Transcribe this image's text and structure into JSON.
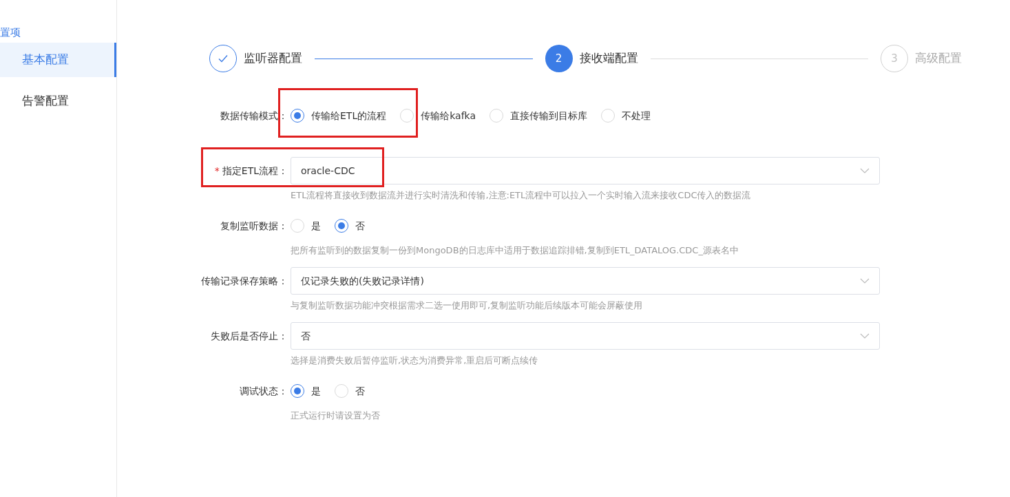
{
  "sidebar": {
    "title": "置项",
    "items": [
      {
        "label": "基本配置",
        "selected": true
      },
      {
        "label": "告警配置",
        "selected": false
      }
    ]
  },
  "steps": [
    {
      "label": "监听器配置",
      "completed": true,
      "selected": false
    },
    {
      "number": "2",
      "label": "接收端配置",
      "completed": false,
      "selected": true
    },
    {
      "number": "3",
      "label": "高级配置",
      "completed": false,
      "selected": false
    }
  ],
  "form": [
    {
      "kind": "radio",
      "label": "数据传输模式：",
      "options": [
        {
          "label": "传输给ETL的流程",
          "selected": true,
          "highlighted": true
        },
        {
          "label": "传输给kafka",
          "selected": false,
          "highlighted": false
        },
        {
          "label": "直接传输到目标库",
          "selected": false,
          "highlighted": false
        },
        {
          "label": "不处理",
          "selected": false,
          "highlighted": false
        }
      ]
    },
    {
      "kind": "select",
      "required_mark": "*",
      "label": "指定ETL流程：",
      "highlighted": true,
      "value": "oracle-CDC",
      "help": "ETL流程将直接收到数据流并进行实时清洗和传输,注意:ETL流程中可以拉入一个实时输入流来接收CDC传入的数据流"
    },
    {
      "kind": "radio",
      "label": "复制监听数据：",
      "options": [
        {
          "label": "是",
          "selected": false,
          "highlighted": false
        },
        {
          "label": "否",
          "selected": true,
          "highlighted": false
        }
      ],
      "help": "把所有监听到的数据复制一份到MongoDB的日志库中适用于数据追踪排错,复制到ETL_DATALOG.CDC_源表名中"
    },
    {
      "kind": "select",
      "label": "传输记录保存策略：",
      "highlighted": false,
      "value": "仅记录失败的(失败记录详情)",
      "help": "与复制监听数据功能冲突根据需求二选一使用即可,复制监听功能后续版本可能会屏蔽使用"
    },
    {
      "kind": "select",
      "label": "失败后是否停止：",
      "highlighted": false,
      "value": "否",
      "help": "选择是消费失败后暂停监听,状态为消费异常,重启后可断点续传"
    },
    {
      "kind": "radio",
      "label": "调试状态：",
      "options": [
        {
          "label": "是",
          "selected": true,
          "highlighted": false
        },
        {
          "label": "否",
          "selected": false,
          "highlighted": false
        }
      ],
      "help": "正式运行时请设置为否"
    }
  ]
}
